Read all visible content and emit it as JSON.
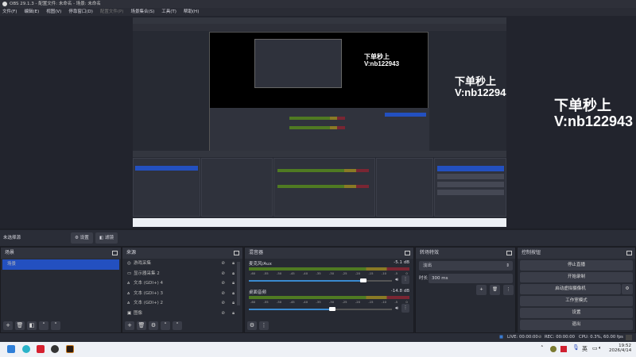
{
  "window": {
    "title": "OBS 29.1.3 - 配置文件: 未命名 - 场景: 未命名"
  },
  "menu": [
    {
      "label": "文件(F)"
    },
    {
      "label": "编辑(E)"
    },
    {
      "label": "视图(V)"
    },
    {
      "label": "停靠窗口(D)"
    },
    {
      "label": "配置文件(P)",
      "disabled": true
    },
    {
      "label": "场景集合(S)"
    },
    {
      "label": "工具(T)"
    },
    {
      "label": "帮助(H)"
    }
  ],
  "overlay": {
    "line1": "下单秒上",
    "line2": "V:nb122943"
  },
  "source_bar": {
    "no_source": "未选择源",
    "settings": "设置",
    "filters": "滤镜"
  },
  "scenes": {
    "title": "场景",
    "items": [
      "场景"
    ]
  },
  "sources": {
    "title": "来源",
    "items": [
      {
        "icon": "gamepad-icon",
        "label": "游戏采集"
      },
      {
        "icon": "monitor-icon",
        "label": "显示器采集 2"
      },
      {
        "icon": "text-icon",
        "label": "文本 (GDI+) 4"
      },
      {
        "icon": "text-icon",
        "label": "文本 (GDI+) 3"
      },
      {
        "icon": "text-icon",
        "label": "文本 (GDI+) 2"
      },
      {
        "icon": "image-icon",
        "label": "图像"
      }
    ]
  },
  "mixer": {
    "title": "混音器",
    "ticks": [
      "-60",
      "-55",
      "-50",
      "-45",
      "-40",
      "-35",
      "-30",
      "-25",
      "-20",
      "-15",
      "-10",
      "-5",
      "0"
    ],
    "channels": [
      {
        "name": "麦克风/Aux",
        "db": "-5.1 dB",
        "volume": 0.8
      },
      {
        "name": "桌面音频",
        "db": "-14.8 dB",
        "volume": 0.58
      }
    ]
  },
  "transitions": {
    "title": "转场特效",
    "type": "淡出",
    "duration_label": "时长",
    "duration": "300 ms"
  },
  "controls": {
    "title": "控制按钮",
    "stop_stream": "停止直播",
    "start_record": "开始录制",
    "virtual_cam": "启动虚拟摄像机",
    "studio_mode": "工作室模式",
    "settings": "设置",
    "exit": "退出"
  },
  "status": {
    "live": "LIVE: 00:00:00",
    "rec": "REC: 00:00:00",
    "cpu": "CPU: 0.3%, 60.00 fps"
  },
  "taskbar": {
    "ime": "英",
    "time": "19:52",
    "date": "2026/4/14"
  },
  "colors": {
    "accent": "#2350c0"
  }
}
